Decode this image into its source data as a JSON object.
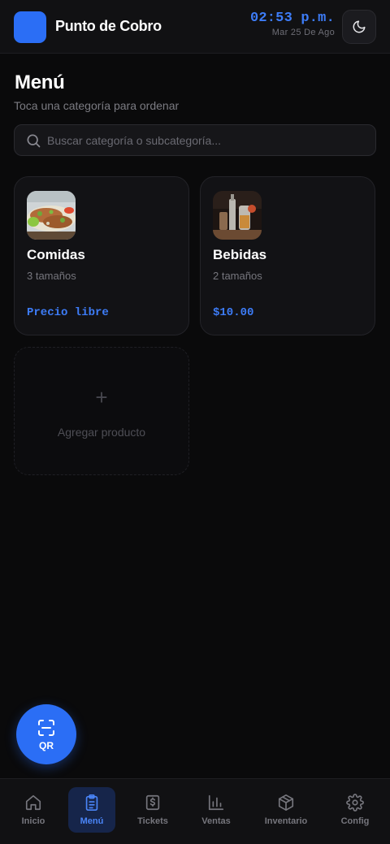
{
  "header": {
    "title": "Punto de Cobro",
    "time": "02:53 p.m.",
    "date": "Mar 25 De Ago",
    "theme_icon": "moon-icon",
    "accent": "#2b6ef5"
  },
  "page": {
    "title": "Menú",
    "subtitle": "Toca una categoría para ordenar"
  },
  "search": {
    "placeholder": "Buscar categoría o subcategoría..."
  },
  "categories": [
    {
      "name": "Comidas",
      "sizes": "3 tamaños",
      "price": "Precio libre",
      "image": "tacos-photo"
    },
    {
      "name": "Bebidas",
      "sizes": "2 tamaños",
      "price": "$10.00",
      "image": "drinks-photo"
    }
  ],
  "add_product": {
    "icon": "plus-icon",
    "label": "Agregar producto"
  },
  "qr_button": {
    "label": "QR",
    "icon": "scan-qr-icon"
  },
  "nav": {
    "items": [
      {
        "label": "Inicio",
        "icon": "home-icon"
      },
      {
        "label": "Menú",
        "icon": "clipboard-icon",
        "active": true
      },
      {
        "label": "Tickets",
        "icon": "receipt-icon"
      },
      {
        "label": "Ventas",
        "icon": "bar-chart-icon"
      },
      {
        "label": "Inventario",
        "icon": "box-icon"
      },
      {
        "label": "Config",
        "icon": "gear-icon"
      }
    ]
  }
}
